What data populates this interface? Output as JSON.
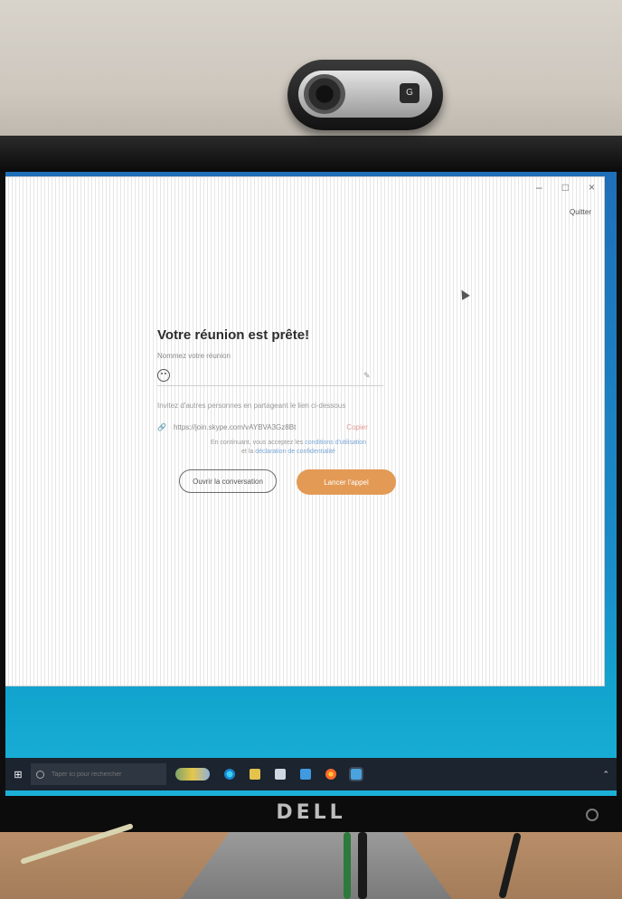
{
  "webcam": {
    "logo_text": "G"
  },
  "monitor": {
    "brand": "DELL"
  },
  "window": {
    "controls": {
      "minimize": "–",
      "maximize": "□",
      "close": "×"
    },
    "quit_label": "Quitter"
  },
  "meeting": {
    "title": "Votre réunion est prête!",
    "name_label": "Nommez votre réunion",
    "name_value": "",
    "invite_text": "Invitez d'autres personnes en partageant le lien ci-dessous",
    "link_text": "https://join.skype.com/vAYBVA3Gz8Bt",
    "copy_label": "Copier",
    "terms_text": "En continuant, vous acceptez les",
    "terms_link": "conditions d'utilisation",
    "privacy_text": "et la",
    "privacy_link": "déclaration de confidentialité",
    "btn_secondary": "Ouvrir la conversation",
    "btn_primary": "Lancer l'appel"
  },
  "taskbar": {
    "search_placeholder": "Taper ici pour rechercher"
  }
}
